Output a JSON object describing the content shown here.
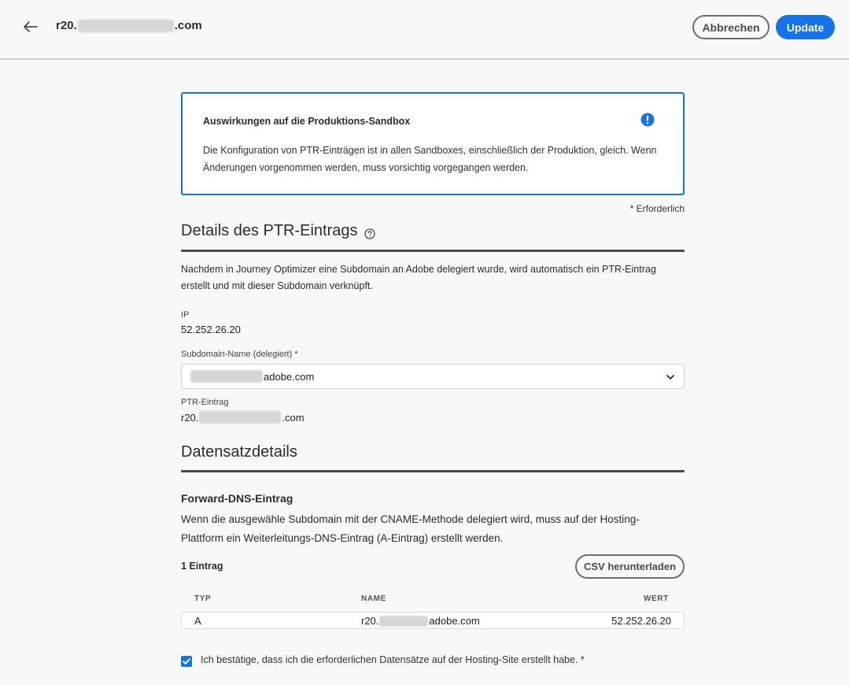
{
  "header": {
    "title_prefix": "r20.",
    "title_suffix": ".com",
    "cancel_label": "Abbrechen",
    "update_label": "Update"
  },
  "alert": {
    "title": "Auswirkungen auf die Produktions-Sandbox",
    "body": "Die Konfiguration von PTR-Einträgen ist in allen Sandboxes, einschließlich der Produktion, gleich. Wenn Änderungen vorgenommen werden, muss vorsichtig vorgegangen werden."
  },
  "required_note": "* Erforderlich",
  "ptr_section": {
    "title": "Details des PTR-Eintrags",
    "description": "Nachdem in Journey Optimizer eine Subdomain an Adobe delegiert wurde, wird automatisch ein PTR-Eintrag erstellt und mit dieser Subdomain verknüpft.",
    "ip_label": "IP",
    "ip_value": "52.252.26.20",
    "subdomain_label": "Subdomain-Name (delegiert)",
    "subdomain_required_mark": "*",
    "subdomain_value_suffix": "adobe.com",
    "ptr_label": "PTR-Eintrag",
    "ptr_value_prefix": "r20.",
    "ptr_value_suffix": ".com"
  },
  "records_section": {
    "title": "Datensatzdetails",
    "forward_title": "Forward-DNS-Eintrag",
    "forward_description": "Wenn die ausgewähle Subdomain mit der CNAME-Methode delegiert wird, muss auf der Hosting-Plattform ein Weiterleitungs-DNS-Eintrag (A-Eintrag) erstellt werden.",
    "count_label": "1 Eintrag",
    "csv_label": "CSV herunterladen",
    "columns": {
      "type": "TYP",
      "name": "NAME",
      "value": "WERT"
    },
    "rows": [
      {
        "type": "A",
        "name_prefix": "r20.",
        "name_suffix": "adobe.com",
        "value": "52.252.26.20"
      }
    ]
  },
  "confirm": {
    "checked": true,
    "label": "Ich bestätige, dass ich die erforderlichen Datensätze auf der Hosting-Site erstellt habe. *"
  },
  "colors": {
    "accent": "#1473e6",
    "text": "#2c2c2c",
    "background": "#f8f8f8"
  }
}
